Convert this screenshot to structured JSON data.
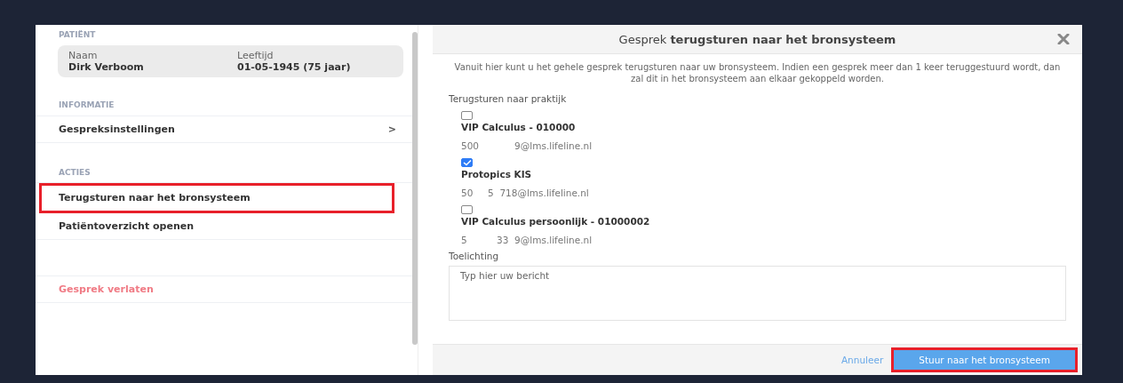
{
  "patient": {
    "heading": "PATIËNT",
    "fields": [
      {
        "label": "Naam",
        "value": "Dirk Verboom"
      },
      {
        "label": "Leeftijd",
        "value": "01-05-1945 (75 jaar)"
      }
    ]
  },
  "information": {
    "heading": "INFORMATIE",
    "items": [
      {
        "label": "Gespreksinstellingen",
        "chevron": ">"
      }
    ]
  },
  "actions": {
    "heading": "ACTIES",
    "items": [
      {
        "label": "Terugsturen naar het bronsysteem",
        "highlighted": true
      },
      {
        "label": "Patiëntoverzicht openen",
        "highlighted": false
      }
    ]
  },
  "leave": {
    "label": "Gesprek verlaten"
  },
  "dialog": {
    "title": "Gesprek **terugsturen naar het bronsysteem**",
    "intro": "Vanuit hier kunt u het gehele gesprek terugsturen naar uw bronsysteem. Indien een gesprek meer dan 1 keer teruggestuurd wordt, dan zal dit in het bronsysteem aan elkaar gekoppeld worden.",
    "practices_label": "Terugsturen naar praktijk",
    "practices": [
      {
        "name": "VIP Calculus - 010000",
        "address": "500            9@lms.lifeline.nl",
        "checked": false
      },
      {
        "name": "Protopics KIS",
        "address": "50     5  718@lms.lifeline.nl",
        "checked": true
      },
      {
        "name": "VIP Calculus persoonlijk - 01000002",
        "address": "5          33  9@lms.lifeline.nl",
        "checked": false
      }
    ],
    "note_label": "Toelichting",
    "note": {
      "placeholder": "Typ hier uw bericht"
    },
    "cancel": "Annuleer",
    "submit": {
      "label": "Stuur naar het bronsysteem",
      "highlighted": true
    }
  }
}
